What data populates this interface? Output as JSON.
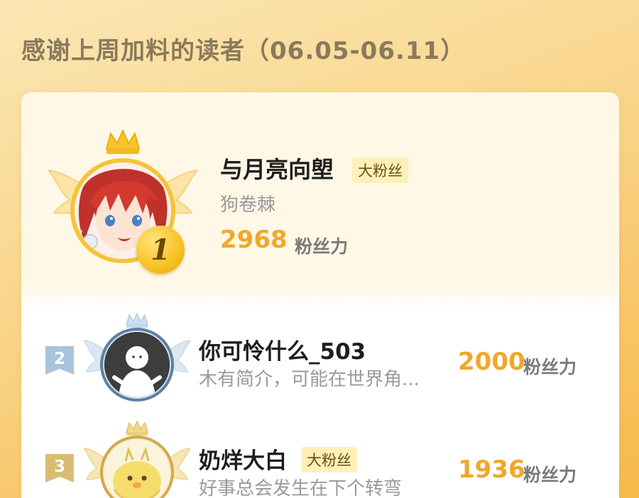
{
  "header": {
    "title": "感谢上周加料的读者（06.05-06.11）"
  },
  "ranking": [
    {
      "rank": "1",
      "name": "与月亮向塱",
      "badge": "大粉丝",
      "bio": "狗卷棘",
      "score": "2968",
      "score_unit": "粉丝力"
    },
    {
      "rank": "2",
      "name": "你可怜什么_503",
      "badge": "",
      "bio": "木有简介，可能在世界角...",
      "score": "2000",
      "score_unit": "粉丝力"
    },
    {
      "rank": "3",
      "name": "奶烊大白",
      "badge": "大粉丝",
      "bio": "好事总会发生在下个转弯",
      "score": "1936",
      "score_unit": "粉丝力"
    }
  ],
  "colors": {
    "accent": "#f0a72a",
    "gold": "#f7c52b",
    "silver": "#9fb9d4",
    "bronze": "#d9b86a"
  },
  "icons": [
    "crown-icon",
    "wings-icon",
    "rank-medal-icon"
  ]
}
